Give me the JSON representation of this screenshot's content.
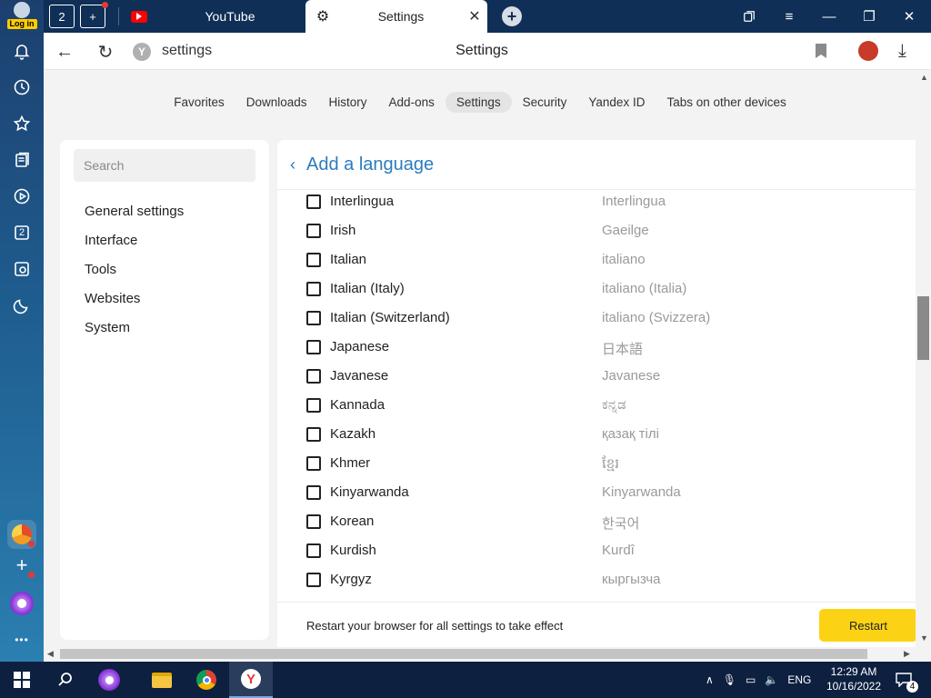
{
  "sidebar": {
    "login_label": "Log in",
    "items": [
      {
        "name": "notifications",
        "icon": "bell-icon"
      },
      {
        "name": "history",
        "icon": "clock-icon"
      },
      {
        "name": "bookmarks",
        "icon": "star-icon"
      },
      {
        "name": "collections",
        "icon": "collections-icon"
      },
      {
        "name": "media",
        "icon": "play-icon"
      },
      {
        "name": "tabs",
        "icon": "tabs-icon",
        "label": "2"
      },
      {
        "name": "screenshot",
        "icon": "camera-icon"
      },
      {
        "name": "night-mode",
        "icon": "moon-icon"
      }
    ],
    "bottom": [
      {
        "name": "app",
        "icon": "pie-icon"
      },
      {
        "name": "add-app",
        "icon": "plus-icon"
      },
      {
        "name": "alice",
        "icon": "alice-icon"
      },
      {
        "name": "more",
        "icon": "more-icon",
        "label": "•••"
      }
    ]
  },
  "tabbar": {
    "home_count": "2",
    "tabs": [
      {
        "title": "YouTube",
        "icon": "youtube-icon"
      },
      {
        "title": "Settings",
        "icon": "gear-icon"
      }
    ]
  },
  "address": {
    "url": "settings",
    "page_title": "Settings"
  },
  "topnav": [
    "Favorites",
    "Downloads",
    "History",
    "Add-ons",
    "Settings",
    "Security",
    "Yandex ID",
    "Tabs on other devices"
  ],
  "topnav_active": "Settings",
  "left_panel": {
    "search_placeholder": "Search",
    "menu": [
      "General settings",
      "Interface",
      "Tools",
      "Websites",
      "System"
    ]
  },
  "right_panel": {
    "title": "Add a language",
    "languages": [
      {
        "name": "Interlingua",
        "native": "Interlingua"
      },
      {
        "name": "Irish",
        "native": "Gaeilge"
      },
      {
        "name": "Italian",
        "native": "italiano"
      },
      {
        "name": "Italian (Italy)",
        "native": "italiano (Italia)"
      },
      {
        "name": "Italian (Switzerland)",
        "native": "italiano (Svizzera)"
      },
      {
        "name": "Japanese",
        "native": "日本語"
      },
      {
        "name": "Javanese",
        "native": "Javanese"
      },
      {
        "name": "Kannada",
        "native": "ಕನ್ನಡ"
      },
      {
        "name": "Kazakh",
        "native": "қазақ тілі"
      },
      {
        "name": "Khmer",
        "native": "ខ្មែរ"
      },
      {
        "name": "Kinyarwanda",
        "native": "Kinyarwanda"
      },
      {
        "name": "Korean",
        "native": "한국어"
      },
      {
        "name": "Kurdish",
        "native": "Kurdî"
      },
      {
        "name": "Kyrgyz",
        "native": "кыргызча"
      }
    ],
    "restart_text": "Restart your browser for all settings to take effect",
    "restart_button": "Restart"
  },
  "taskbar": {
    "language": "ENG",
    "time": "12:29 AM",
    "date": "10/16/2022",
    "notification_count": "4"
  },
  "colors": {
    "accent": "#2c7bbf",
    "restart_button": "#fcd314",
    "tabbar": "#0f2f57",
    "taskbar": "#0e2040"
  }
}
